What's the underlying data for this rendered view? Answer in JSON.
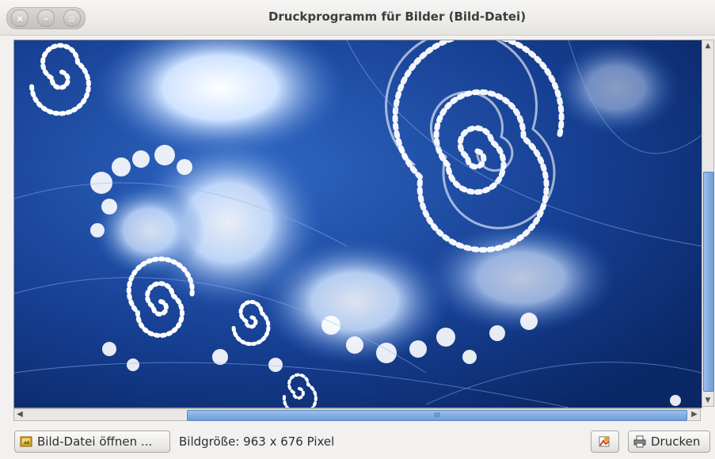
{
  "window": {
    "title": "Druckprogramm für Bilder (Bild-Datei)",
    "close_glyph": "×",
    "minimize_glyph": "–",
    "maximize_glyph": "▫"
  },
  "image": {
    "description_icon": "fractal-spiral-image",
    "colors": {
      "dark": "#0c2d72",
      "mid": "#2f66c2",
      "light": "#cfe3ff",
      "white": "#ffffff"
    }
  },
  "scrollbars": {
    "up_glyph": "▲",
    "down_glyph": "▼",
    "left_glyph": "◀",
    "right_glyph": "▶",
    "grip_glyph": "III"
  },
  "toolbar": {
    "open_label": "Bild-Datei öffnen ...",
    "status_text": "Bildgröße: 963 x 676 Pixel",
    "print_label": "Drucken"
  }
}
